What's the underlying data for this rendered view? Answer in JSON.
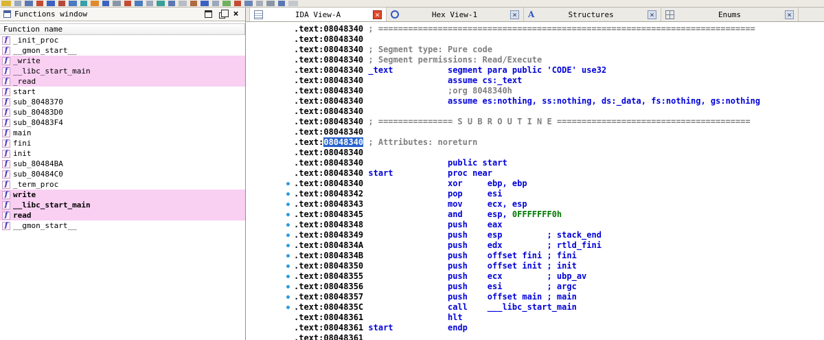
{
  "glyphs": {
    "close": "×",
    "function_icon_letter": "f",
    "structures_icon_letter": "A"
  },
  "colors": {
    "instruction": "#0000d8",
    "comment": "#808080",
    "number": "#007800",
    "auto_comment": "#0000d8",
    "address": "#000000",
    "selected_addr_bg": "#2a63cc",
    "selected_addr_fg": "#ffffff",
    "pink_row": "#f9cff2",
    "dot": "#2f9ae0",
    "close_active_bg": "#e1472b"
  },
  "toolbar_strip": {
    "blocks": [
      {
        "c": "#d9b435",
        "w": 14
      },
      {
        "c": "#9aa7bd",
        "w": 10
      },
      {
        "c": "#5a77b4",
        "w": 12
      },
      {
        "c": "#c44a32",
        "w": 10
      },
      {
        "c": "#3b62c0",
        "w": 12
      },
      {
        "c": "#b44a3a",
        "w": 10
      },
      {
        "c": "#4a7ac0",
        "w": 12
      },
      {
        "c": "#38a0a8",
        "w": 10
      },
      {
        "c": "#e08a2e",
        "w": 12
      },
      {
        "c": "#3b62c0",
        "w": 10
      },
      {
        "c": "#8a96a8",
        "w": 12
      },
      {
        "c": "#c44a32",
        "w": 10
      },
      {
        "c": "#4a7ac0",
        "w": 12
      },
      {
        "c": "#9aa7bd",
        "w": 10
      },
      {
        "c": "#38a098",
        "w": 12
      },
      {
        "c": "#5a77b4",
        "w": 10
      },
      {
        "c": "#b8bcc4",
        "w": 12
      },
      {
        "c": "#b06a40",
        "w": 10
      },
      {
        "c": "#3b62c0",
        "w": 12
      },
      {
        "c": "#9aa7bd",
        "w": 10
      },
      {
        "c": "#70b060",
        "w": 12
      },
      {
        "c": "#c44a32",
        "w": 10
      },
      {
        "c": "#6a86b8",
        "w": 12
      },
      {
        "c": "#a8aeb8",
        "w": 10
      },
      {
        "c": "#8a96a8",
        "w": 12
      },
      {
        "c": "#5a77b4",
        "w": 10
      },
      {
        "c": "#c4c8ce",
        "w": 14
      }
    ]
  },
  "functions_window": {
    "title": "Functions window",
    "column_header": "Function name",
    "items": [
      {
        "label": "_init_proc",
        "pink": false,
        "bold": false
      },
      {
        "label": "__gmon_start__",
        "pink": false,
        "bold": false
      },
      {
        "label": "_write",
        "pink": true,
        "bold": false
      },
      {
        "label": "__libc_start_main",
        "pink": true,
        "bold": false
      },
      {
        "label": "_read",
        "pink": true,
        "bold": false
      },
      {
        "label": "start",
        "pink": false,
        "bold": false
      },
      {
        "label": "sub_8048370",
        "pink": false,
        "bold": false
      },
      {
        "label": "sub_80483D0",
        "pink": false,
        "bold": false
      },
      {
        "label": "sub_80483F4",
        "pink": false,
        "bold": false
      },
      {
        "label": "main",
        "pink": false,
        "bold": false
      },
      {
        "label": "fini",
        "pink": false,
        "bold": false
      },
      {
        "label": "init",
        "pink": false,
        "bold": false
      },
      {
        "label": "sub_80484BA",
        "pink": false,
        "bold": false
      },
      {
        "label": "sub_80484C0",
        "pink": false,
        "bold": false
      },
      {
        "label": "_term_proc",
        "pink": false,
        "bold": false
      },
      {
        "label": "write",
        "pink": true,
        "bold": true
      },
      {
        "label": "__libc_start_main",
        "pink": true,
        "bold": true
      },
      {
        "label": "read",
        "pink": true,
        "bold": true
      },
      {
        "label": "__gmon_start__",
        "pink": false,
        "bold": false
      }
    ]
  },
  "tab_bar": {
    "tabs": [
      {
        "label": "IDA View-A",
        "icon": "ida-view",
        "active": true
      },
      {
        "label": "Hex View-1",
        "icon": "hex-view",
        "active": false
      },
      {
        "label": "Structures",
        "icon": "structures",
        "active": false
      },
      {
        "label": "Enums",
        "icon": "enums",
        "active": false
      }
    ]
  },
  "disassembly": {
    "segment_prefix": ".text",
    "lines": [
      {
        "addr": "08048340",
        "spans": [
          [
            "; ============================================================================",
            "cmt"
          ]
        ]
      },
      {
        "addr": "08048340",
        "spans": []
      },
      {
        "addr": "08048340",
        "spans": [
          [
            "; Segment type: Pure code",
            "cmt"
          ]
        ]
      },
      {
        "addr": "08048340",
        "spans": [
          [
            "; Segment permissions: Read/Execute",
            "cmt"
          ]
        ]
      },
      {
        "addr": "08048340",
        "spans": [
          [
            "_text           segment para public 'CODE' use32",
            "ins"
          ]
        ]
      },
      {
        "addr": "08048340",
        "spans": [
          [
            "                assume cs:_text",
            "ins"
          ]
        ]
      },
      {
        "addr": "08048340",
        "spans": [
          [
            "                ;org 8048340h",
            "cmt"
          ]
        ]
      },
      {
        "addr": "08048340",
        "spans": [
          [
            "                assume es:nothing, ss:nothing, ds:_data, fs:nothing, gs:nothing",
            "ins"
          ]
        ]
      },
      {
        "addr": "08048340",
        "spans": []
      },
      {
        "addr": "08048340",
        "spans": [
          [
            "; =============== S U B R O U T I N E =======================================",
            "cmt"
          ]
        ]
      },
      {
        "addr": "08048340",
        "spans": []
      },
      {
        "addr": "08048340",
        "sel": true,
        "spans": [
          [
            "; Attributes: noreturn",
            "cmt"
          ]
        ]
      },
      {
        "addr": "08048340",
        "spans": []
      },
      {
        "addr": "08048340",
        "spans": [
          [
            "                public start",
            "ins"
          ]
        ]
      },
      {
        "addr": "08048340",
        "spans": [
          [
            "start           proc near",
            "ins"
          ]
        ]
      },
      {
        "addr": "08048340",
        "dot": true,
        "spans": [
          [
            "                xor     ebp, ebp",
            "ins"
          ]
        ]
      },
      {
        "addr": "08048342",
        "dot": true,
        "spans": [
          [
            "                pop     esi",
            "ins"
          ]
        ]
      },
      {
        "addr": "08048343",
        "dot": true,
        "spans": [
          [
            "                mov     ecx, esp",
            "ins"
          ]
        ]
      },
      {
        "addr": "08048345",
        "dot": true,
        "spans": [
          [
            "                and     esp, ",
            "ins"
          ],
          [
            "0FFFFFFF0h",
            "num"
          ]
        ]
      },
      {
        "addr": "08048348",
        "dot": true,
        "spans": [
          [
            "                push    eax",
            "ins"
          ]
        ]
      },
      {
        "addr": "08048349",
        "dot": true,
        "spans": [
          [
            "                push    esp         ",
            "ins"
          ],
          [
            "; stack_end",
            "acmt"
          ]
        ]
      },
      {
        "addr": "0804834A",
        "dot": true,
        "spans": [
          [
            "                push    edx         ",
            "ins"
          ],
          [
            "; rtld_fini",
            "acmt"
          ]
        ]
      },
      {
        "addr": "0804834B",
        "dot": true,
        "spans": [
          [
            "                push    offset fini ",
            "ins"
          ],
          [
            "; fini",
            "acmt"
          ]
        ]
      },
      {
        "addr": "08048350",
        "dot": true,
        "spans": [
          [
            "                push    offset init ",
            "ins"
          ],
          [
            "; init",
            "acmt"
          ]
        ]
      },
      {
        "addr": "08048355",
        "dot": true,
        "spans": [
          [
            "                push    ecx         ",
            "ins"
          ],
          [
            "; ubp_av",
            "acmt"
          ]
        ]
      },
      {
        "addr": "08048356",
        "dot": true,
        "spans": [
          [
            "                push    esi         ",
            "ins"
          ],
          [
            "; argc",
            "acmt"
          ]
        ]
      },
      {
        "addr": "08048357",
        "dot": true,
        "spans": [
          [
            "                push    offset main ",
            "ins"
          ],
          [
            "; main",
            "acmt"
          ]
        ]
      },
      {
        "addr": "0804835C",
        "dot": true,
        "spans": [
          [
            "                call    ___libc_start_main",
            "ins"
          ]
        ]
      },
      {
        "addr": "08048361",
        "spans": [
          [
            "                hlt",
            "ins"
          ]
        ]
      },
      {
        "addr": "08048361",
        "spans": [
          [
            "start           endp",
            "ins"
          ]
        ]
      },
      {
        "addr": "08048361",
        "spans": []
      }
    ]
  }
}
